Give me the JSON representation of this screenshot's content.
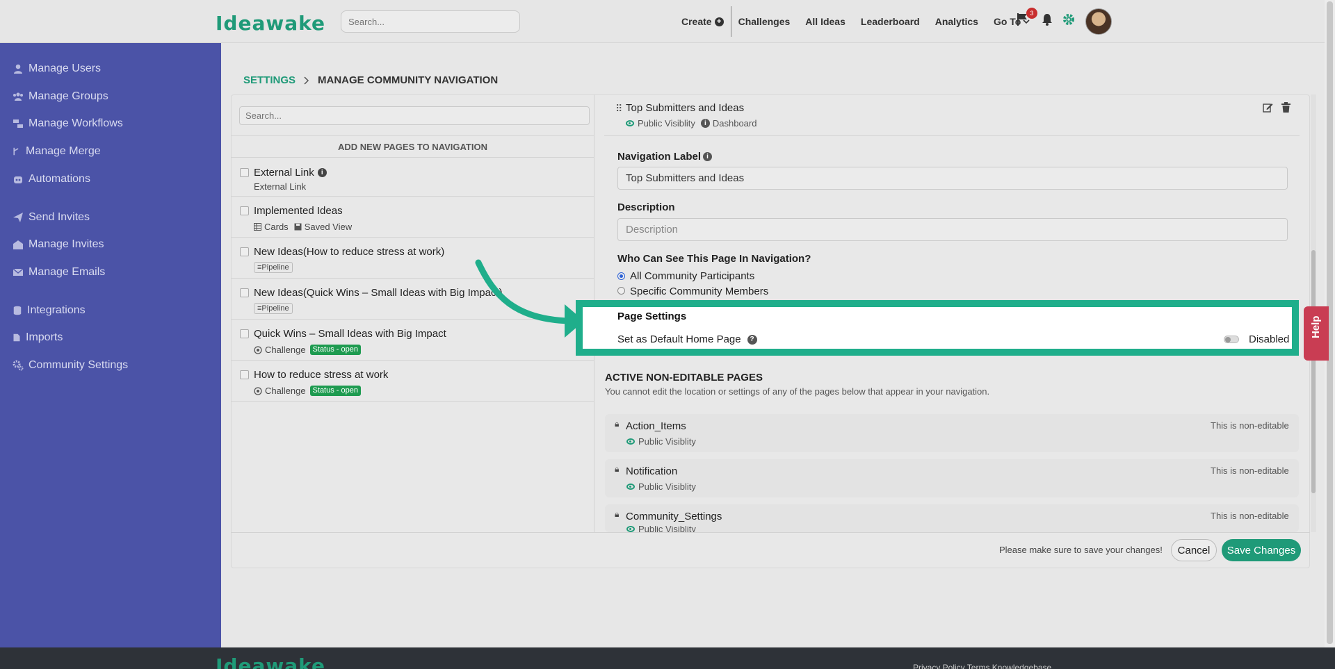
{
  "header": {
    "logo": "Ideawake",
    "search_placeholder": "Search...",
    "nav": [
      "Create",
      "Challenges",
      "All Ideas",
      "Leaderboard",
      "Analytics",
      "Go To"
    ],
    "notification_count": "3"
  },
  "sidebar": {
    "items": [
      {
        "label": "Manage Users",
        "icon": "user-icon"
      },
      {
        "label": "Manage Groups",
        "icon": "users-icon"
      },
      {
        "label": "Manage Workflows",
        "icon": "workflow-icon"
      },
      {
        "label": "Manage Merge",
        "icon": "merge-icon"
      },
      {
        "label": "Automations",
        "icon": "robot-icon"
      },
      {
        "label": "Send Invites",
        "icon": "paper-plane-icon"
      },
      {
        "label": "Manage Invites",
        "icon": "envelope-open-icon"
      },
      {
        "label": "Manage Emails",
        "icon": "envelope-icon"
      },
      {
        "label": "Integrations",
        "icon": "database-icon"
      },
      {
        "label": "Imports",
        "icon": "file-import-icon"
      },
      {
        "label": "Community Settings",
        "icon": "cogs-icon"
      }
    ]
  },
  "breadcrumb": {
    "root": "SETTINGS",
    "current": "MANAGE COMMUNITY NAVIGATION"
  },
  "left_panel": {
    "search_placeholder": "Search...",
    "add_new_label": "ADD NEW PAGES TO NAVIGATION",
    "pages": [
      {
        "title": "External Link",
        "sub": "External Link"
      },
      {
        "title": "Implemented Ideas",
        "sub1": "Cards",
        "sub2": "Saved View"
      },
      {
        "title": "New Ideas(How to reduce stress at work)",
        "tag": "Pipeline"
      },
      {
        "title": "New Ideas(Quick Wins – Small Ideas with Big Impact)",
        "tag": "Pipeline"
      },
      {
        "title": "Quick Wins – Small Ideas with Big Impact",
        "sub": "Challenge",
        "status": "Status - open"
      },
      {
        "title": "How to reduce stress at work",
        "sub": "Challenge",
        "status": "Status - open"
      }
    ]
  },
  "right_panel": {
    "selected": {
      "title": "Top Submitters and Ideas",
      "visibility": "Public Visiblity",
      "type": "Dashboard"
    },
    "nav_label": {
      "label": "Navigation Label",
      "value": "Top Submitters and Ideas"
    },
    "description": {
      "label": "Description",
      "placeholder": "Description"
    },
    "who_can_see": {
      "label": "Who Can See This Page In Navigation?",
      "options": [
        "All Community Participants",
        "Specific Community Members"
      ],
      "selected": "All Community Participants"
    },
    "page_settings": {
      "title": "Page Settings",
      "default_label": "Set as Default Home Page",
      "toggle_state": "Disabled"
    },
    "active_pages": {
      "title": "ACTIVE NON-EDITABLE PAGES",
      "subtitle": "You cannot edit the location or settings of any of the pages below that appear in your navigation.",
      "note": "This is non-editable",
      "items": [
        {
          "title": "Action_Items",
          "visibility": "Public Visiblity"
        },
        {
          "title": "Notification",
          "visibility": "Public Visiblity"
        },
        {
          "title": "Community_Settings",
          "visibility": "Public Visiblity"
        }
      ]
    }
  },
  "footer": {
    "save_note": "Please make sure to save your changes!",
    "cancel_label": "Cancel",
    "save_label": "Save Changes",
    "links": "Privacy Policy   Terms   Knowledgebase"
  },
  "help": {
    "label": "Help"
  },
  "colors": {
    "brand": "#1f9a78",
    "sidebar": "#4b53a7",
    "highlight": "#1fae8b",
    "help": "#c93d53"
  }
}
